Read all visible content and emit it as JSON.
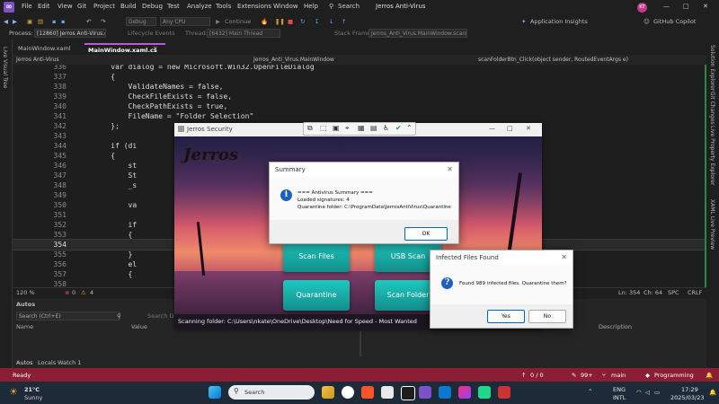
{
  "menubar": {
    "items": [
      "File",
      "Edit",
      "View",
      "Git",
      "Project",
      "Build",
      "Debug",
      "Test",
      "Analyze",
      "Tools",
      "Extensions",
      "Window",
      "Help"
    ],
    "search_label": "Search",
    "window_title": "Jerros Anti-Virus",
    "avatar_initials": "KT"
  },
  "toolbar": {
    "config_value": "Debug",
    "platform_value": "Any CPU",
    "continue_label": "Continue",
    "app_insights_label": "Application Insights",
    "copilot_label": "GitHub Copilot"
  },
  "debug_toolbar": {
    "process_label": "Process:",
    "process_value": "[12860] Jerros Anti-Virus.exe",
    "lifecycle_label": "Lifecycle Events",
    "thread_label": "Thread:",
    "thread_value": "[6432] Main Thread",
    "stack_label": "Stack Frame:",
    "stack_value": "Jerros_Anti_Virus.MainWindow.scanFolde..."
  },
  "left_tools": {
    "label": "Live Visual Tree"
  },
  "right_tools": {
    "items": [
      "Solution Explorer",
      "Git Changes",
      "Live Property Explorer",
      "XAML Live Preview"
    ]
  },
  "doc_tabs": [
    {
      "label": "MainWindow.xaml"
    },
    {
      "label": "MainWindow.xaml.cs"
    }
  ],
  "nav": {
    "project": "Jerros Anti-Virus",
    "class": "Jerros_Anti_Virus.MainWindow",
    "member": "scanFolderBtn_Click(object sender, RoutedEventArgs e)"
  },
  "code_lines": [
    {
      "n": "336",
      "text": "    var dialog = new Microsoft.Win32.OpenFileDialog"
    },
    {
      "n": "337",
      "text": "    {"
    },
    {
      "n": "338",
      "text": "        ValidateNames = false,"
    },
    {
      "n": "339",
      "text": "        CheckFileExists = false,"
    },
    {
      "n": "340",
      "text": "        CheckPathExists = true,"
    },
    {
      "n": "341",
      "text": "        FileName = \"Folder Selection\""
    },
    {
      "n": "342",
      "text": "    };"
    },
    {
      "n": "343",
      "text": ""
    },
    {
      "n": "344",
      "text": "    if (di"
    },
    {
      "n": "345",
      "text": "    {"
    },
    {
      "n": "346",
      "text": "        st"
    },
    {
      "n": "347",
      "text": "        St"
    },
    {
      "n": "348",
      "text": "        _s"
    },
    {
      "n": "349",
      "text": ""
    },
    {
      "n": "350",
      "text": "        va"
    },
    {
      "n": "351",
      "text": ""
    },
    {
      "n": "352",
      "text": "        if"
    },
    {
      "n": "353",
      "text": "        {"
    },
    {
      "n": "354",
      "text": ""
    },
    {
      "n": "355",
      "text": "        }"
    },
    {
      "n": "356",
      "text": "        el"
    },
    {
      "n": "357",
      "text": "        {"
    },
    {
      "n": "358",
      "text": ""
    },
    {
      "n": "359",
      "text": "        }"
    }
  ],
  "editor_status": {
    "zoom": "120 %",
    "errors": "0",
    "warnings": "4",
    "position": "Ln: 354",
    "column": "Ch: 64",
    "spacing": "SPC",
    "line_ending": "CRLF"
  },
  "autos": {
    "title": "Autos",
    "search_placeholder": "Search (Ctrl+E)",
    "search_depth": "Search Depth",
    "col_name": "Name",
    "col_value": "Value",
    "col_description": "Description",
    "tabs": [
      "Autos",
      "Locals",
      "Watch 1"
    ]
  },
  "statusbar": {
    "ready": "Ready",
    "up": "0 / 0",
    "changes": "99+",
    "branch": "main",
    "repo": "Programming"
  },
  "app": {
    "title": "Jerros Security",
    "logo_text": "Jerros",
    "buttons": [
      "Scan Files",
      "USB Scan",
      "Quarantine",
      "Scan Folder"
    ],
    "status": "Scanning folder: C:\\Users\\nkate\\OneDrive\\Desktop\\Need for Speed - Most Wanted"
  },
  "summary_dialog": {
    "title": "Summary",
    "lines": [
      "=== Antivirus Summary ===",
      "Loaded signatures: 4",
      "Quarantine folder: C:\\ProgramData\\JerrosAntiVirus\\Quarantine"
    ],
    "ok_label": "OK"
  },
  "infected_dialog": {
    "title": "Infected Files Found",
    "message": "Found 989 infected files. Quarantine them?",
    "yes_label": "Yes",
    "no_label": "No"
  },
  "taskbar": {
    "weather_temp": "21°C",
    "weather_desc": "Sunny",
    "search_label": "Search",
    "lang1": "ENG",
    "lang2": "INTL",
    "time": "17:29",
    "date": "2025/03/23"
  },
  "colors": {
    "accent": "#7b53c9",
    "statusbar": "#8b1d34",
    "app_button": "#20c9c0"
  }
}
